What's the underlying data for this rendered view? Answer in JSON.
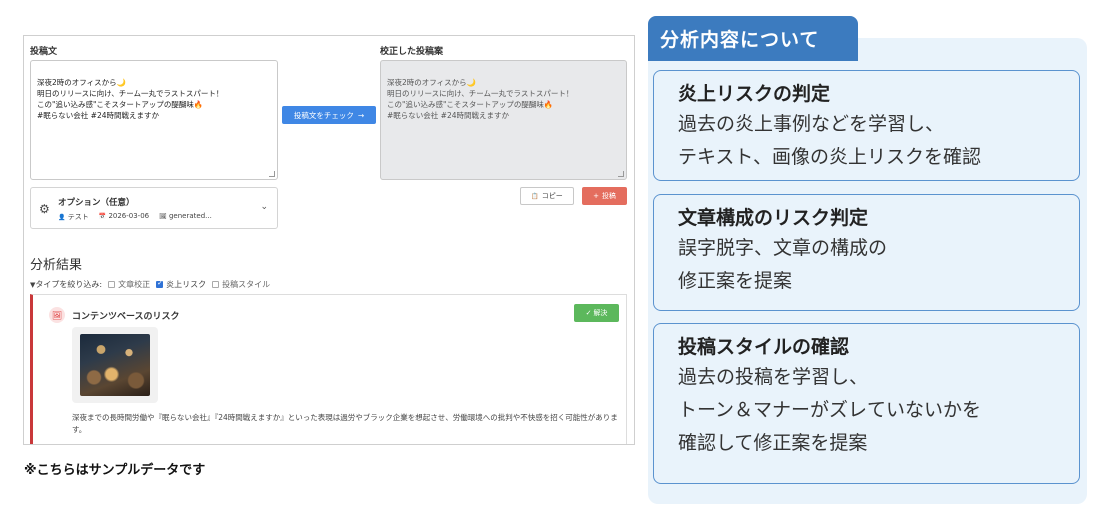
{
  "editor": {
    "original_label": "投稿文",
    "corrected_label": "校正した投稿案",
    "original_text": "深夜2時のオフィスから🌙\n明日のリリースに向け、チーム一丸でラストスパート！\nこの\"追い込み感\"こそスタートアップの醍醐味🔥\n#眠らない会社 #24時間戦えますか",
    "corrected_text": "深夜2時のオフィスから🌙\n明日のリリースに向け、チーム一丸でラストスパート！\nこの\"追い込み感\"こそスタートアップの醍醐味🔥\n#眠らない会社 #24時間戦えますか",
    "check_button": "投稿文をチェック",
    "check_arrow": "→"
  },
  "options": {
    "gear_glyph": "⚙",
    "title": "オプション（任意）",
    "user_glyph": "👤",
    "user": "テスト",
    "date_glyph": "📅",
    "date": "2026-03-06",
    "image_glyph": "🖼",
    "image": "generated...",
    "chevron": "⌄"
  },
  "actions": {
    "copy_glyph": "📋",
    "copy": "コピー",
    "post_glyph": "+",
    "post": "投稿"
  },
  "results": {
    "title": "分析結果",
    "filter_glyph": "▼",
    "filter_label": "タイプを絞り込み:",
    "filters": [
      {
        "label": "文章校正",
        "checked": false
      },
      {
        "label": "炎上リスク",
        "checked": true
      },
      {
        "label": "投稿スタイル",
        "checked": false
      }
    ],
    "card": {
      "icon_glyph": "🖼",
      "title": "コンテンツベースのリスク",
      "resolve_glyph": "✓",
      "resolve": "解決",
      "description": "深夜までの長時間労働や『眠らない会社』『24時間戦えますか』といった表現は過労やブラック企業を想起させ、労働環境への批判や不快感を招く可能性があります。"
    }
  },
  "sample_note": "※こちらはサンプルデータです",
  "panel": {
    "tab": "分析内容について",
    "boxes": [
      {
        "title": "炎上リスクの判定",
        "lines": [
          "過去の炎上事例などを学習し、",
          "テキスト、画像の炎上リスクを確認"
        ]
      },
      {
        "title": "文章構成のリスク判定",
        "lines": [
          "誤字脱字、文章の構成の",
          "修正案を提案"
        ]
      },
      {
        "title": "投稿スタイルの確認",
        "lines": [
          "過去の投稿を学習し、",
          "トーン＆マナーがズレていないかを",
          "確認して修正案を提案"
        ]
      }
    ]
  },
  "colors": {
    "primary_blue": "#3f87e5",
    "post_red": "#e46d5e",
    "resolve_green": "#5cb85c",
    "risk_red": "#c9383a",
    "panel_blue": "#3c7bbf",
    "panel_bg": "#e9f3fb"
  }
}
